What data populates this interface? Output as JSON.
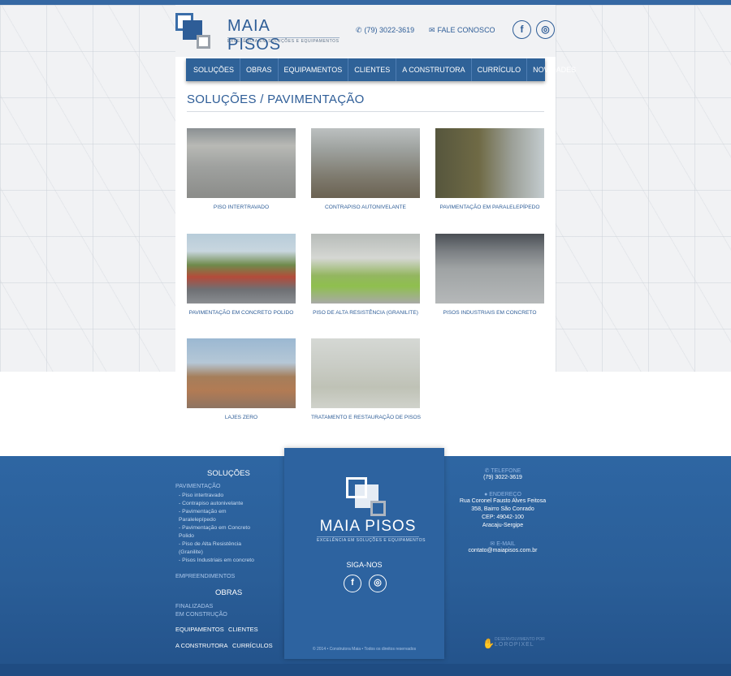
{
  "brand": {
    "name": "MAIA PISOS",
    "tagline": "EXCELÊNCIA EM SOLUÇÕES E EQUIPAMENTOS"
  },
  "header": {
    "phone": "(79) 3022-3619",
    "contact_link": "FALE CONOSCO",
    "social": {
      "facebook": "f",
      "instagram": "◎"
    }
  },
  "nav": [
    "SOLUÇÕES",
    "OBRAS",
    "EQUIPAMENTOS",
    "CLIENTES",
    "A CONSTRUTORA",
    "CURRÍCULO",
    "NOVIDADES"
  ],
  "page_title": "SOLUÇÕES / PAVIMENTAÇÃO",
  "gallery": [
    "PISO INTERTRAVADO",
    "CONTRAPISO AUTONIVELANTE",
    "PAVIMENTAÇÃO EM PARALELEPÍPEDO",
    "PAVIMENTAÇÃO EM CONCRETO POLIDO",
    "PISO DE ALTA RESISTÊNCIA (GRANILITE)",
    "PISOS INDUSTRIAIS EM CONCRETO",
    "LAJES ZERO",
    "TRATAMENTO E RESTAURAÇÃO DE PISOS"
  ],
  "footer": {
    "solucoes_heading": "SOLUÇÕES",
    "pavimentacao_link": "PAVIMENTAÇÃO",
    "sublinks": {
      "s1": "- Piso intertravado",
      "s2": "- Contrapiso autonivelante",
      "s3a": "- Pavimentação em",
      "s3b": "Paralelepípedo",
      "s4a": "- Pavimentação em Concreto",
      "s4b": "Polido",
      "s5a": "- Piso de Alta Resistência",
      "s5b": "(Granilite)",
      "s6": "- Pisos Industriais em concreto"
    },
    "empreendimentos": "EMPREENDIMENTOS",
    "obras_heading": "OBRAS",
    "finalizadas": "FINALIZADAS",
    "em_construcao": "EM CONSTRUÇÃO",
    "equipamentos": "EQUIPAMENTOS",
    "clientes": "CLIENTES",
    "a_construtora": "A CONSTRUTORA",
    "curriculos": "CURRÍCULOS",
    "siga": "SIGA-NOS",
    "telefone_label": "TELEFONE",
    "telefone_value": "(79) 3022-3619",
    "endereco_label": "ENDEREÇO",
    "endereco_lines": [
      "Rua Coronel Fausto Alves Feitosa",
      "358, Bairro São Conrado",
      "CEP: 49042-100",
      "Aracaju-Sergipe"
    ],
    "email_label": "E-MAIL",
    "email_value": "contato@maiapisos.com.br",
    "copyright": "© 2014 • Construtora Maia • Todos os direitos reservados",
    "dev_label": "DESENVOLVIMENTO POR",
    "dev_name": "LOROPIXEL"
  },
  "colors": {
    "primary": "#2e5d97",
    "footer": "#2a5e98"
  }
}
